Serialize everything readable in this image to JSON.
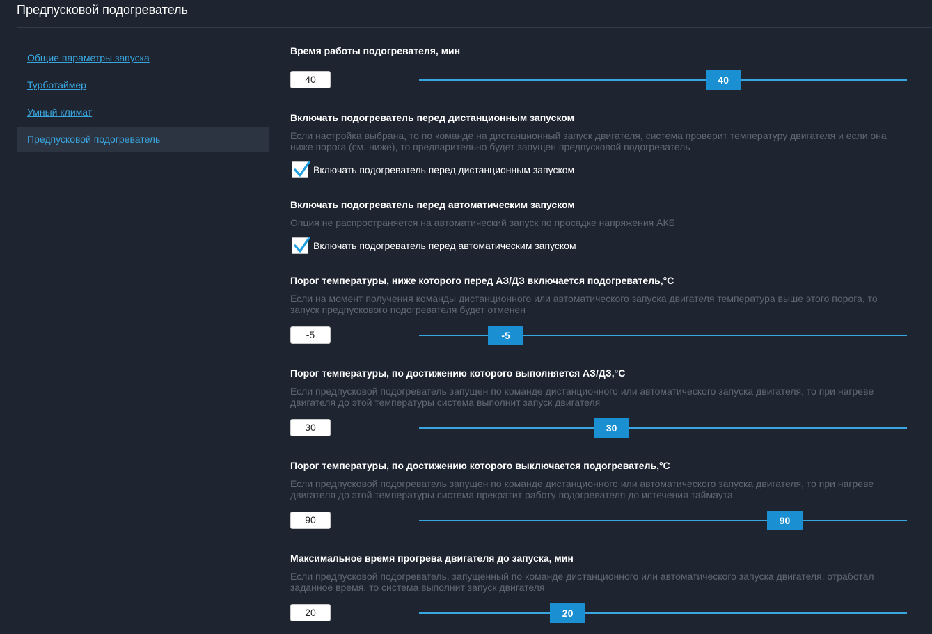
{
  "page": {
    "title": "Предпусковой подогреватель"
  },
  "sidebar": {
    "items": [
      {
        "label": "Общие параметры запуска"
      },
      {
        "label": "Турботаймер"
      },
      {
        "label": "Умный климат"
      },
      {
        "label": "Предпусковой подогреватель",
        "active": true
      }
    ]
  },
  "settings": {
    "heater_runtime": {
      "title": "Время работы подогревателя, мин",
      "value": "40",
      "slider_fraction": 0.623
    },
    "remote_start_heater": {
      "title": "Включать подогреватель перед дистанционным запуском",
      "description": "Если настройка выбрана, то по команде на дистанционный запуск двигателя, система проверит температуру двигателя и если она ниже порога (см. ниже), то предварительно будет запущен предпусковой подогреватель",
      "checkbox_label": "Включать подогреватель перед дистанционным запуском",
      "checked": true
    },
    "auto_start_heater": {
      "title": "Включать подогреватель перед автоматическим запуском",
      "description": "Опция не распространяется на автоматический запуск по просадке напряжения АКБ",
      "checkbox_label": "Включать подогреватель перед автоматическим запуском",
      "checked": true
    },
    "temp_threshold_on": {
      "title": "Порог температуры, ниже которого перед АЗ/ДЗ включается подогреватель,°C",
      "description": "Если на момент получения команды дистанционного или автоматического запуска двигателя температура выше этого порога, то запуск предпускового подогревателя будет отменен",
      "value": "-5",
      "slider_fraction": 0.177
    },
    "temp_threshold_start": {
      "title": "Порог температуры, по достижению которого выполняется АЗ/ДЗ,°C",
      "description": "Если предпусковой подогреватель запущен по команде дистанционного или автоматического запуска двигателя, то при нагреве двигателя до этой температуры система выполнит запуск двигателя",
      "value": "30",
      "slider_fraction": 0.394
    },
    "temp_threshold_off": {
      "title": "Порог температуры, по достижению которого выключается подогреватель,°C",
      "description": "Если предпусковой подогреватель запущен по команде дистанционного или автоматического запуска двигателя, то при нагреве двигателя до этой температуры система прекратит работу подогревателя до истечения таймаута",
      "value": "90",
      "slider_fraction": 0.749
    },
    "max_warmup_time": {
      "title": "Максимальное время прогрева двигателя до запуска, мин",
      "description": "Если предпусковой подогреватель, запущенный по команде дистанционного или автоматического запуска двигателя, отработал заданное время, то система выполнит запуск двигателя",
      "value": "20",
      "slider_fraction": 0.304
    }
  },
  "colors": {
    "background": "#1e2530",
    "accent": "#3aa6e0",
    "thumb": "#1a8fd1",
    "muted_text": "#5f6875",
    "active_sidebar": "#2c3441"
  },
  "icons": {
    "checkbox": "checkmark-icon"
  }
}
